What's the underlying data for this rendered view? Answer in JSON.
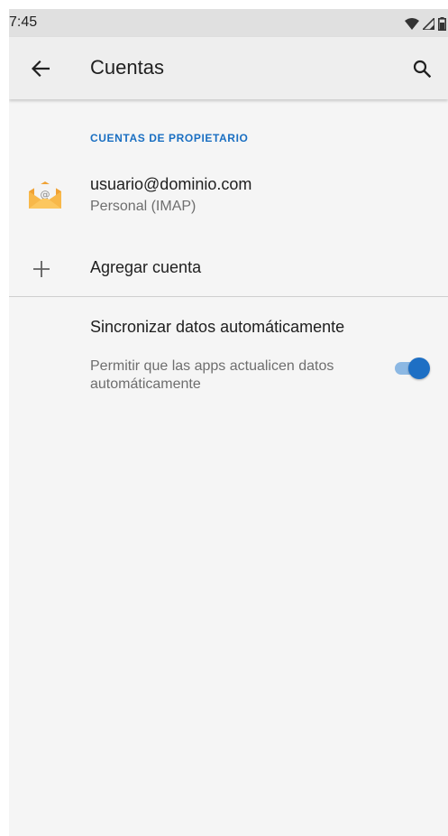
{
  "status_bar": {
    "time": "7:45",
    "icons": [
      "wifi-icon",
      "signal-icon",
      "battery-icon"
    ]
  },
  "app_bar": {
    "title": "Cuentas",
    "back_icon": "arrow-back-icon",
    "search_icon": "search-icon"
  },
  "section": {
    "header": "CUENTAS DE PROPIETARIO"
  },
  "account": {
    "email": "usuario@dominio.com",
    "type": "Personal (IMAP)",
    "icon": "email-envelope-icon"
  },
  "add_account": {
    "label": "Agregar cuenta",
    "icon": "plus-icon"
  },
  "sync": {
    "title": "Sincronizar datos automáticamente",
    "summary": "Permitir que las apps actualicen datos automáticamente",
    "enabled": true
  },
  "colors": {
    "accent": "#1e6fc4",
    "section_header": "#1a6fc2",
    "background": "#f5f5f5",
    "app_bar": "#eeeeee",
    "status_bar": "#e0e0e0"
  }
}
